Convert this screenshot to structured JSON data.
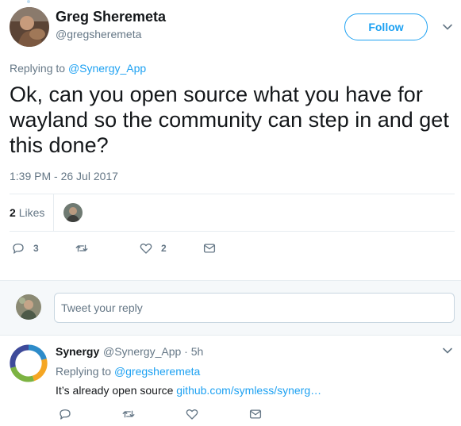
{
  "main_tweet": {
    "author_name": "Greg Sheremeta",
    "author_handle": "@gregsheremeta",
    "follow_label": "Follow",
    "replying_prefix": "Replying to",
    "replying_to": "@Synergy_App",
    "text": "Ok, can you open source what you have for wayland so the community can step in and get this done?",
    "timestamp": "1:39 PM - 26 Jul 2017",
    "likes_count": "2",
    "likes_label": "Likes",
    "actions": {
      "reply_count": "3",
      "retweet_count": "",
      "like_count": "2"
    }
  },
  "reply_box": {
    "placeholder": "Tweet your reply"
  },
  "reply_tweet": {
    "author_name": "Synergy",
    "meta": "@Synergy_App · 5h",
    "replying_prefix": "Replying to",
    "replying_to": "@gregsheremeta",
    "text_prefix": "It’s already open source",
    "link_text": "github.com/symless/synerg…"
  },
  "colors": {
    "accent": "#1da1f2",
    "muted": "#657786",
    "border": "#e6ecf0",
    "background_alt": "#f5f8fa"
  }
}
